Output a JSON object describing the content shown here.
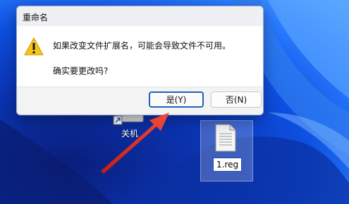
{
  "dialog": {
    "title": "重命名",
    "message_line1": "如果改变文件扩展名，可能会导致文件不可用。",
    "message_line2": "确实要更改吗?",
    "yes_label": "是(Y)",
    "no_label": "否(N)"
  },
  "desktop": {
    "shortcut_label": "关机",
    "file_label": "1.reg",
    "icons": {
      "warning": "warning-triangle",
      "shortcut": "shutdown-shortcut",
      "file": "reg-file"
    }
  },
  "colors": {
    "accent": "#1f5fbf",
    "arrow": "#e53a2e",
    "warning": "#f2c200"
  }
}
